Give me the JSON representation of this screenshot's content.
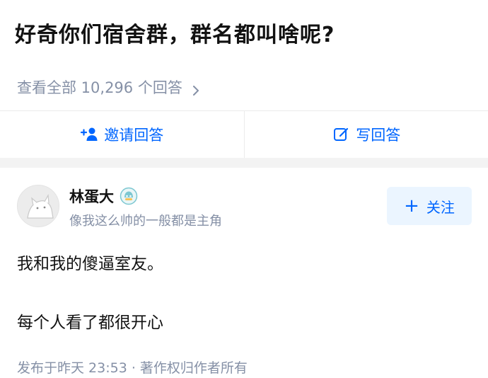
{
  "question": {
    "title": "好奇你们宿舍群，群名都叫啥呢?",
    "view_all": "查看全部 10,296 个回答"
  },
  "actions": {
    "invite_label": "邀请回答",
    "write_label": "写回答"
  },
  "answer": {
    "author_name": "林蛋大",
    "author_bio": "像我这么帅的一般都是主角",
    "follow_label": "关注",
    "lines": [
      "我和我的傻逼室友。",
      "每个人看了都很开心"
    ],
    "meta": "发布于昨天 23:53 · 著作权归作者所有"
  },
  "icons": {
    "view_all_arrow": "chevron-right-icon",
    "invite": "add-user-icon",
    "write": "edit-icon",
    "badge": "verified-badge-icon",
    "follow": "plus-icon"
  },
  "colors": {
    "accent": "#0066ff",
    "muted": "#8590a6",
    "text": "#121212",
    "follow_bg": "#ebf5ff",
    "band": "#f3f3f3"
  }
}
